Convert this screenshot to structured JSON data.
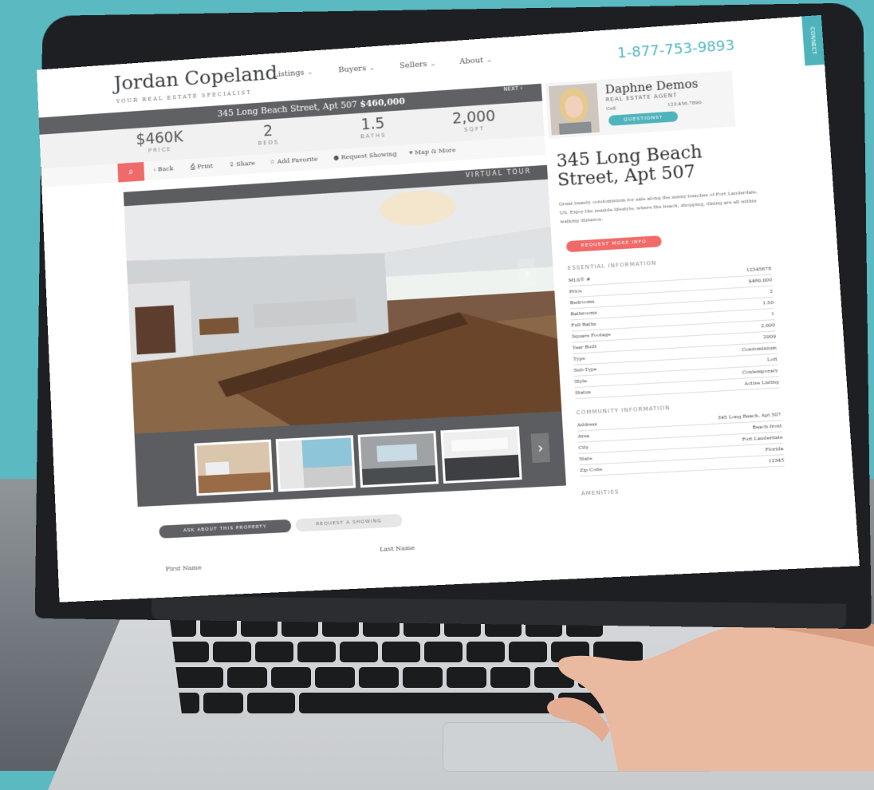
{
  "site": {
    "brand_name": "Jordan Copeland",
    "brand_tagline": "YOUR REAL ESTATE SPECIALIST",
    "nav": [
      "Listings",
      "Buyers",
      "Sellers",
      "About"
    ],
    "phone": "1-877-753-9893",
    "connect_label": "CONNECT"
  },
  "listing_bar": {
    "address": "345 Long Beach Street, Apt 507",
    "price": "$460,000",
    "next_label": "NEXT ›"
  },
  "stats": [
    {
      "value": "$460K",
      "label": "PRICE"
    },
    {
      "value": "2",
      "label": "BEDS"
    },
    {
      "value": "1.5",
      "label": "BATHS"
    },
    {
      "value": "2,000",
      "label": "SQFT"
    }
  ],
  "toolbar": {
    "search_icon": "search-icon",
    "items": [
      {
        "icon": "‹",
        "label": "Back"
      },
      {
        "icon": "⎙",
        "label": "Print"
      },
      {
        "icon": "⇪",
        "label": "Share"
      },
      {
        "icon": "☆",
        "label": "Add Favorite"
      },
      {
        "icon": "●",
        "label": "Request Showing"
      },
      {
        "icon": "⌖",
        "label": "Map & More"
      }
    ]
  },
  "gallery": {
    "tour_label": "VIRTUAL TOUR",
    "thumb_count": 4
  },
  "agent": {
    "name": "Daphne Demos",
    "title": "REAL ESTATE AGENT",
    "cell_label": "Cell",
    "cell_value": "123.456.7890",
    "questions_label": "QUESTIONS?"
  },
  "details": {
    "title": "345 Long Beach Street, Apt 507",
    "description": "Great beauty condominium for sale along the sunny beaches of Fort Lauderdale, US. Enjoy the seaside lifestyle, where the beach, shopping, dining are all within walking distance.",
    "request_info_label": "REQUEST MORE INFO",
    "essential_heading": "ESSENTIAL INFORMATION",
    "essential": [
      {
        "k": "MLS® #",
        "v": "12345678"
      },
      {
        "k": "Price",
        "v": "$460,000"
      },
      {
        "k": "Bedrooms",
        "v": "2"
      },
      {
        "k": "Bathrooms",
        "v": "1.50"
      },
      {
        "k": "Full Baths",
        "v": "1"
      },
      {
        "k": "Square Footage",
        "v": "2,000"
      },
      {
        "k": "Year Built",
        "v": "2009"
      },
      {
        "k": "Type",
        "v": "Condominium"
      },
      {
        "k": "Sub-Type",
        "v": "Loft"
      },
      {
        "k": "Style",
        "v": "Contemporary"
      },
      {
        "k": "Status",
        "v": "Active Listing"
      }
    ],
    "community_heading": "COMMUNITY INFORMATION",
    "community": [
      {
        "k": "Address",
        "v": "345 Long Beach, Apt 507"
      },
      {
        "k": "Area",
        "v": "Beach front"
      },
      {
        "k": "City",
        "v": "Fort Lauderdale"
      },
      {
        "k": "State",
        "v": "Florida"
      },
      {
        "k": "Zip Code",
        "v": "12345"
      }
    ],
    "amenities_heading": "AMENITIES"
  },
  "form": {
    "tab_ask": "ASK ABOUT THIS PROPERTY",
    "tab_showing": "REQUEST A SHOWING",
    "first_name_label": "First Name",
    "last_name_label": "Last Name"
  }
}
